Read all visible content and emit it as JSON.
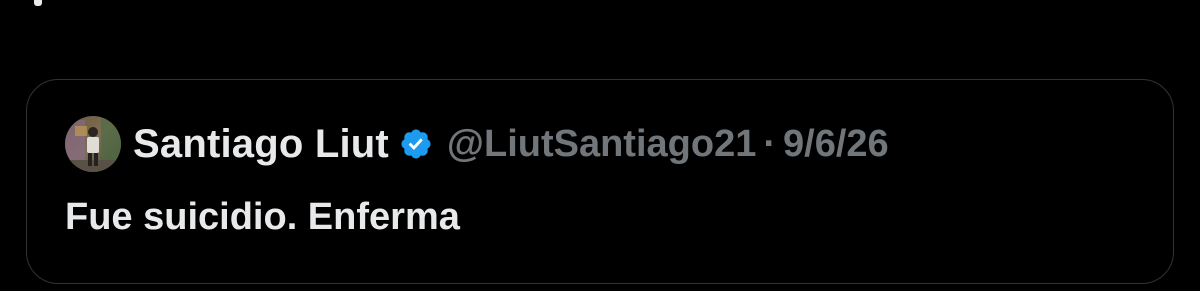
{
  "quote": {
    "author": {
      "display_name": "Santiago Liut",
      "handle": "@LiutSantiago21",
      "verified_icon": "verified-badge-icon"
    },
    "separator": "·",
    "date": "9/6/26",
    "text": "Fue suicidio. Enferma"
  },
  "colors": {
    "background": "#000000",
    "primary_text": "#e7e9ea",
    "secondary_text": "#71767b",
    "verified_blue": "#1d9bf0",
    "border": "#2f3336"
  }
}
